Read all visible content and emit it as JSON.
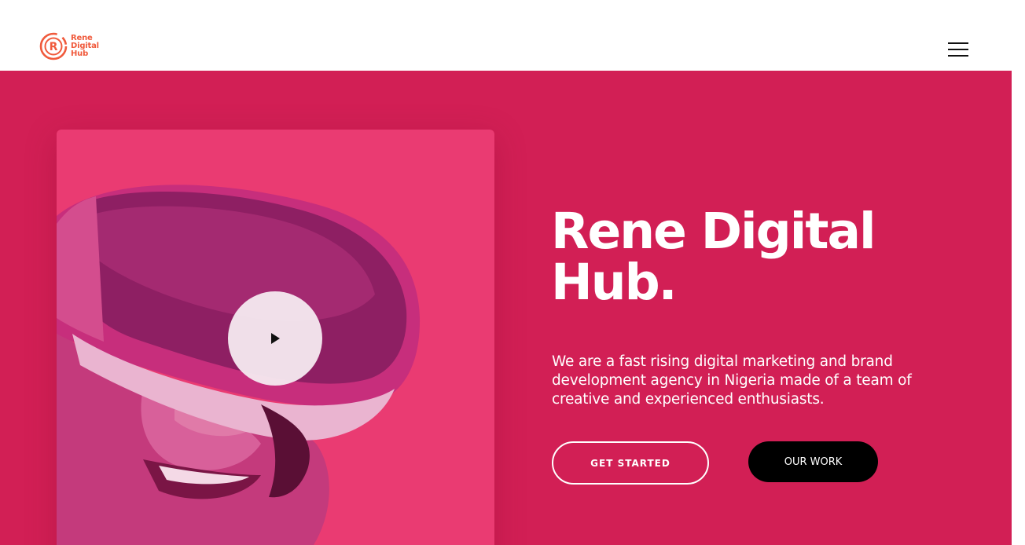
{
  "brand": {
    "logo_lines": [
      "Rene",
      "Digital",
      "Hub"
    ],
    "logo_color": "#f05a3c"
  },
  "header": {
    "menu_icon": "hamburger-menu-icon"
  },
  "hero": {
    "title": "Rene Digital Hub.",
    "description": "We are a fast rising digital marketing and brand development agency in Nigeria made of a team of creative and experienced enthusiasts.",
    "primary_button": "GET STARTED",
    "secondary_button": "OUR WORK",
    "play_icon": "play-icon",
    "background_color": "#d21f55",
    "card_color": "#ea3b72"
  }
}
